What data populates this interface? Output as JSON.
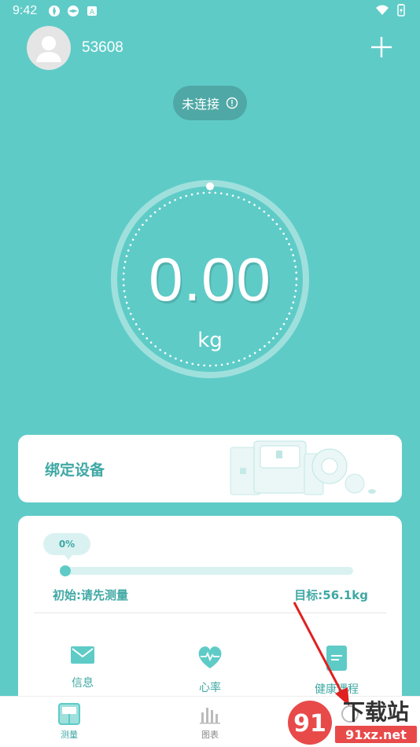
{
  "status_bar": {
    "time": "9:42"
  },
  "header": {
    "username": "53608"
  },
  "connection": {
    "status": "未连接"
  },
  "scale": {
    "weight": "0.00",
    "unit": "kg"
  },
  "bind_card": {
    "title": "绑定设备"
  },
  "progress": {
    "percent_label": "0%",
    "progress_fraction": 0,
    "start_label": "初始:请先测量",
    "target_label": "目标:56.1kg"
  },
  "features": [
    {
      "label": "信息",
      "icon": "mail-icon"
    },
    {
      "label": "心率",
      "icon": "heart-rate-icon"
    },
    {
      "label": "健康课程",
      "icon": "course-book-icon"
    }
  ],
  "nav": [
    {
      "label": "测量",
      "icon": "scale-icon"
    },
    {
      "label": "图表",
      "icon": "chart-icon"
    },
    {
      "label": "",
      "icon": "nav-icon"
    }
  ],
  "watermark": {
    "text_top": "下载站",
    "text_bottom": "91xz.net",
    "logo": "91"
  },
  "colors": {
    "primary": "#5ECBC7",
    "accent_text": "#3FA8A4",
    "pill_bg": "#4FA8A5",
    "track_bg": "#D9F2F1",
    "arrow": "#E02020"
  }
}
